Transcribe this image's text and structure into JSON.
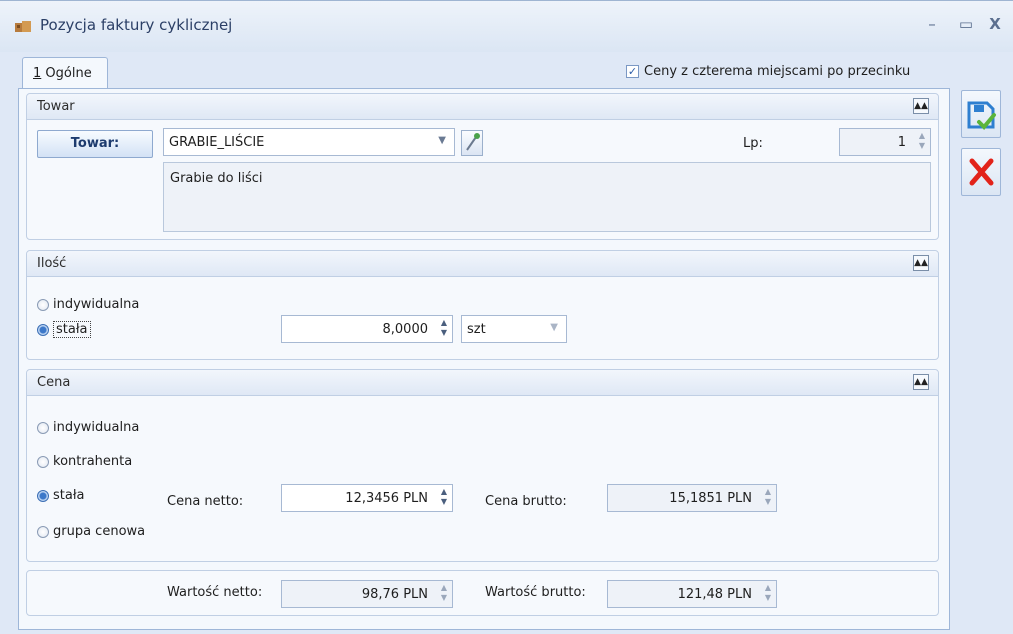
{
  "window": {
    "title": "Pozycja faktury cyklicznej",
    "controls": {
      "minimize": "–",
      "maximize": "▭",
      "close": "X"
    }
  },
  "tab": {
    "number": "1",
    "label": "Ogólne"
  },
  "price_decimals": {
    "label": "Ceny z czterema miejscami po przecinku",
    "checked": true
  },
  "towar_group": {
    "title": "Towar",
    "button": "Towar:",
    "code": "GRABIE_LIŚCIE",
    "lp_label": "Lp:",
    "lp_value": "1",
    "description": "Grabie do liści"
  },
  "ilosc_group": {
    "title": "Ilość",
    "options": [
      "indywidualna",
      "stała"
    ],
    "selected": "stała",
    "quantity": "8,0000",
    "unit": "szt"
  },
  "cena_group": {
    "title": "Cena",
    "options": [
      "indywidualna",
      "kontrahenta",
      "stała",
      "grupa cenowa"
    ],
    "selected": "stała",
    "netto_label": "Cena netto:",
    "netto_value": "12,3456 PLN",
    "brutto_label": "Cena brutto:",
    "brutto_value": "15,1851 PLN"
  },
  "wartosc": {
    "netto_label": "Wartość netto:",
    "netto_value": "98,76 PLN",
    "brutto_label": "Wartość brutto:",
    "brutto_value": "121,48 PLN"
  },
  "side_buttons": {
    "save": "save-icon",
    "cancel": "cancel-icon"
  },
  "colors": {
    "accent": "#2b5ca8",
    "cancel": "#e2231a",
    "save": "#2e7fd0"
  }
}
